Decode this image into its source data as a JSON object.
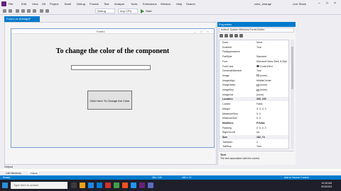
{
  "menu": {
    "items": [
      "File",
      "Edit",
      "View",
      "Git",
      "Project",
      "Build",
      "Debug",
      "Format",
      "Test",
      "Analyze",
      "Tools",
      "Extensions",
      "Window",
      "Help",
      "Search"
    ],
    "solution_title": "color_change",
    "user": "Live Share"
  },
  "toolbar": {
    "config": "Debug",
    "platform": "Any CPU",
    "start_label": "Start"
  },
  "editor": {
    "tab_label": "Form1.cs [Design]*",
    "form_title": "Form1",
    "heading": "To change the color of the component",
    "button_label": "Click Here To Change the Color"
  },
  "properties": {
    "header": "Properties",
    "object": "button1 System.Windows.Forms.Button",
    "rows": [
      {
        "name": "Dock",
        "value": "None"
      },
      {
        "name": "Enabled",
        "value": "True"
      },
      {
        "name": "FlatAppearance",
        "value": ""
      },
      {
        "name": "FlatStyle",
        "value": "Standard"
      },
      {
        "name": "Font",
        "value": "Microsoft Sans Serif, 8.25pt"
      },
      {
        "name": "ForeColor",
        "value": "ControlText",
        "swatch": "#000000"
      },
      {
        "name": "GenerateMember",
        "value": "True"
      },
      {
        "name": "Image",
        "value": "(none)",
        "swatch": "#ffffff"
      },
      {
        "name": "ImageAlign",
        "value": "MiddleCenter"
      },
      {
        "name": "ImageIndex",
        "value": "(none)",
        "swatch": "#ffffff"
      },
      {
        "name": "ImageKey",
        "value": "(none)",
        "swatch": "#ffffff"
      },
      {
        "name": "ImageList",
        "value": "(none)"
      },
      {
        "name": "Location",
        "value": "353, 225"
      },
      {
        "name": "Locked",
        "value": "False"
      },
      {
        "name": "Margin",
        "value": "3, 3, 3, 3"
      },
      {
        "name": "MaximumSize",
        "value": "0, 0"
      },
      {
        "name": "MinimumSize",
        "value": "0, 0"
      },
      {
        "name": "Modifiers",
        "value": "Private"
      },
      {
        "name": "Padding",
        "value": "0, 0, 0, 0"
      },
      {
        "name": "RightToLeft",
        "value": "No"
      },
      {
        "name": "Size",
        "value": "182, 74"
      },
      {
        "name": "TabIndex",
        "value": "2"
      },
      {
        "name": "TabStop",
        "value": "True"
      }
    ],
    "desc_title": "Text",
    "desc_text": "The text associated with the control."
  },
  "output": {
    "header": "Output",
    "tabs": [
      "Call Hierarchy",
      "Output"
    ]
  },
  "statusbar": {
    "left": "Ready",
    "position": "384, 225",
    "size": "182 x 74",
    "right": "Add to Source Control"
  },
  "taskbar": {
    "search_placeholder": "Type here to search",
    "time": "10:45 AM",
    "date": "3/15/2021"
  },
  "colors": {
    "accent": "#007acc",
    "vs_purple": "#68217a",
    "taskbar": "#1f1f2b"
  }
}
